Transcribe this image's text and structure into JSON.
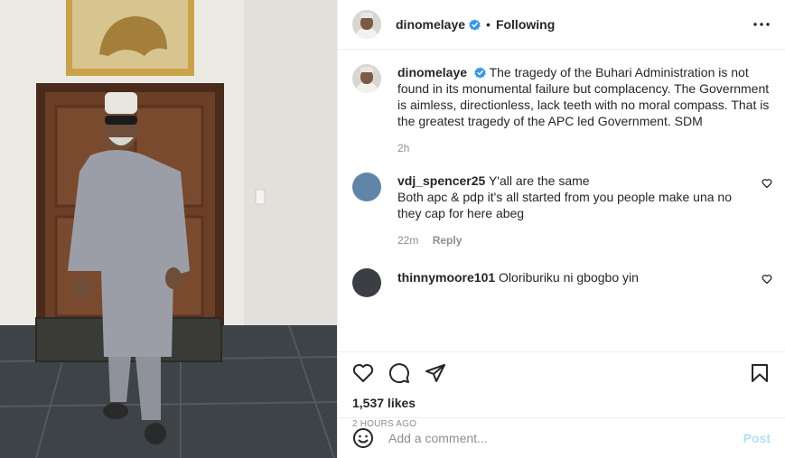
{
  "photo": {
    "alt_subject": "man-in-grey-kaftan-photo"
  },
  "header": {
    "username": "dinomelaye",
    "separator": "•",
    "follow_status": "Following"
  },
  "caption": {
    "username": "dinomelaye",
    "text": "The tragedy of the Buhari Administration is not found in its monumental failure but complacency. The Government is aimless, directionless, lack teeth with no moral compass. That is the greatest tragedy of the APC led Government. SDM",
    "time": "2h"
  },
  "comments": [
    {
      "username": "vdj_spencer25",
      "text": "Y'all are the same\nBoth apc & pdp it's all started from you people make una no they cap for here abeg",
      "line1": "Y'all are the same",
      "line2": "Both apc & pdp it's all started from you people make una no they cap for here abeg",
      "time": "22m",
      "reply_label": "Reply"
    },
    {
      "username": "thinnymoore101",
      "text": "Oloriburiku ni gbogbo yin"
    }
  ],
  "actions": {
    "likes": "1,537 likes",
    "posted_ago": "2 HOURS AGO"
  },
  "add_comment": {
    "placeholder": "Add a comment...",
    "post_label": "Post"
  },
  "colors": {
    "verified_blue": "#3897f0",
    "post_button_disabled": "#b2dffc",
    "muted_text": "#8e8e8e",
    "border": "#efefef"
  },
  "icons": [
    "verified-badge-icon",
    "more-options-icon",
    "heart-icon",
    "comment-icon",
    "share-icon",
    "bookmark-icon",
    "emoji-icon"
  ]
}
